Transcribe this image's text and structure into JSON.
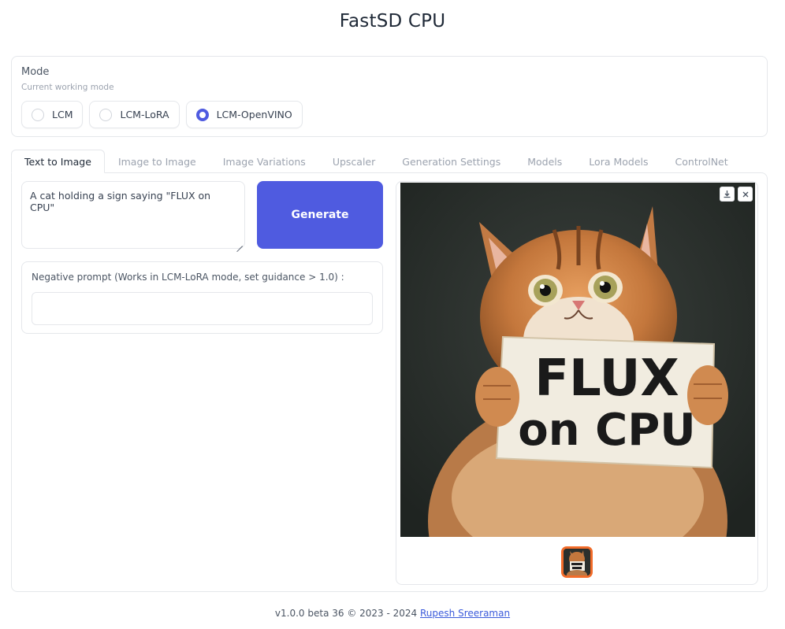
{
  "app": {
    "title": "FastSD CPU"
  },
  "mode": {
    "label": "Mode",
    "info": "Current working mode",
    "options": [
      {
        "label": "LCM",
        "checked": false
      },
      {
        "label": "LCM-LoRA",
        "checked": false
      },
      {
        "label": "LCM-OpenVINO",
        "checked": true
      }
    ]
  },
  "tabs": [
    {
      "label": "Text to Image",
      "active": true
    },
    {
      "label": "Image to Image",
      "active": false
    },
    {
      "label": "Image Variations",
      "active": false
    },
    {
      "label": "Upscaler",
      "active": false
    },
    {
      "label": "Generation Settings",
      "active": false
    },
    {
      "label": "Models",
      "active": false
    },
    {
      "label": "Lora Models",
      "active": false
    },
    {
      "label": "ControlNet",
      "active": false
    }
  ],
  "text_to_image": {
    "prompt_value": "A cat holding a sign saying \"FLUX on CPU\"",
    "generate_label": "Generate",
    "negative_prompt_label": "Negative prompt (Works in LCM-LoRA mode, set guidance > 1.0) :",
    "negative_prompt_value": ""
  },
  "gallery": {
    "sign_line1": "FLUX",
    "sign_line2": "on CPU",
    "download_icon": "download-icon",
    "close_icon": "close-icon"
  },
  "footer": {
    "version_text": "v1.0.0 beta 36 © 2023 - 2024 ",
    "author_link": "Rupesh Sreeraman"
  },
  "colors": {
    "accent": "#4f5be0",
    "thumb_border": "#f26c2a"
  }
}
